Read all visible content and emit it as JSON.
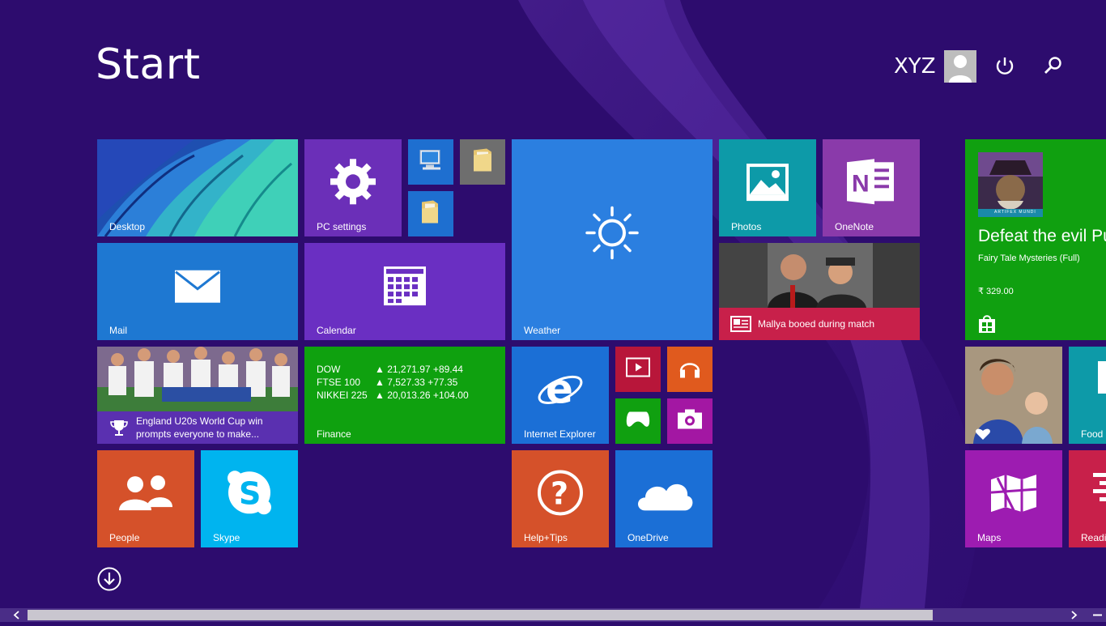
{
  "screen": {
    "title": "Start"
  },
  "user": {
    "name": "XYZ"
  },
  "icons": {
    "avatar": "user-avatar-icon",
    "power": "power-icon",
    "search": "search-icon",
    "all_apps": "down-arrow-circle-icon"
  },
  "tiles": {
    "desktop": {
      "label": "Desktop"
    },
    "pc_settings": {
      "label": "PC settings"
    },
    "mail": {
      "label": "Mail"
    },
    "calendar": {
      "label": "Calendar"
    },
    "weather": {
      "label": "Weather"
    },
    "photos": {
      "label": "Photos"
    },
    "onenote": {
      "label": "OneNote"
    },
    "news": {
      "headline": "Mallya booed during match"
    },
    "sport": {
      "headline_line1": "England U20s World Cup win",
      "headline_line2": "prompts everyone to make..."
    },
    "finance": {
      "label": "Finance",
      "rows": [
        {
          "name": "DOW",
          "value": "▲ 21,271.97 +89.44"
        },
        {
          "name": "FTSE 100",
          "value": "▲ 7,527.33 +77.35"
        },
        {
          "name": "NIKKEI 225",
          "value": "▲ 20,013.26 +104.00"
        }
      ]
    },
    "ie": {
      "label": "Internet Explorer"
    },
    "people": {
      "label": "People"
    },
    "skype": {
      "label": "Skype"
    },
    "help": {
      "label": "Help+Tips"
    },
    "onedrive": {
      "label": "OneDrive"
    },
    "store_game": {
      "headline": "Defeat the evil Pu",
      "app_name": "Fairy Tale Mysteries (Full)",
      "price": "₹ 329.00",
      "brand": "ARTIFEX MUNDI"
    },
    "food": {
      "label": "Food"
    },
    "maps": {
      "label": "Maps"
    },
    "reading": {
      "label": "Readi"
    }
  },
  "colors": {
    "background": "#2d0c6e",
    "pc_settings": "#6b2fb8",
    "mail": "#1e78d2",
    "calendar": "#6a2fc2",
    "weather": "#2b7fe0",
    "photos": "#0d9aa8",
    "onenote": "#8a3aaa",
    "news": "#c8204a",
    "finance": "#0fa10f",
    "ie": "#1b6fd6",
    "people": "#d5512a",
    "skype": "#00b4ef",
    "help": "#d5512a",
    "onedrive": "#1b6fd6",
    "store": "#10a010",
    "maps": "#9d1cb1",
    "video": "#b8163a",
    "music": "#e05a1e",
    "games": "#10a010",
    "camera": "#a317a3"
  }
}
